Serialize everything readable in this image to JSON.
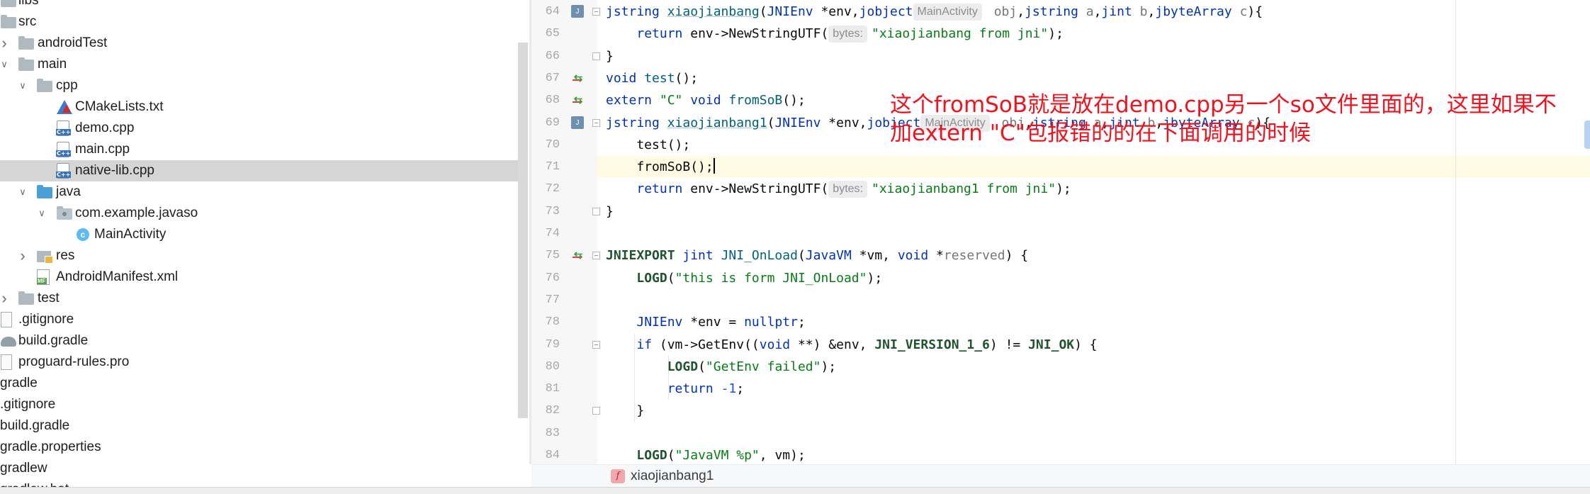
{
  "project_tree": {
    "items": [
      {
        "label": "libs",
        "indent": 0,
        "icon": "folder-icon",
        "chevron": ""
      },
      {
        "label": "src",
        "indent": 0,
        "icon": "folder-icon",
        "chevron": "down"
      },
      {
        "label": "androidTest",
        "indent": 1,
        "icon": "folder-icon",
        "chevron": "right"
      },
      {
        "label": "main",
        "indent": 1,
        "icon": "folder-icon",
        "chevron": "down"
      },
      {
        "label": "cpp",
        "indent": 2,
        "icon": "folder-icon",
        "chevron": "down"
      },
      {
        "label": "CMakeLists.txt",
        "indent": 3,
        "icon": "cmake-icon",
        "chevron": ""
      },
      {
        "label": "demo.cpp",
        "indent": 3,
        "icon": "cpp-file-icon",
        "chevron": ""
      },
      {
        "label": "main.cpp",
        "indent": 3,
        "icon": "cpp-file-icon",
        "chevron": ""
      },
      {
        "label": "native-lib.cpp",
        "indent": 3,
        "icon": "cpp-file-icon",
        "chevron": "",
        "selected": true
      },
      {
        "label": "java",
        "indent": 2,
        "icon": "source-folder-icon",
        "chevron": "down"
      },
      {
        "label": "com.example.javaso",
        "indent": 3,
        "icon": "package-icon",
        "chevron": "down"
      },
      {
        "label": "MainActivity",
        "indent": 4,
        "icon": "class-icon",
        "chevron": ""
      },
      {
        "label": "res",
        "indent": 2,
        "icon": "resources-folder-icon",
        "chevron": "right"
      },
      {
        "label": "AndroidManifest.xml",
        "indent": 2,
        "icon": "manifest-file-icon",
        "chevron": ""
      },
      {
        "label": "test",
        "indent": 1,
        "icon": "folder-icon",
        "chevron": "right"
      },
      {
        "label": ".gitignore",
        "indent": 0,
        "icon": "gitignore-file-icon",
        "chevron": ""
      },
      {
        "label": "build.gradle",
        "indent": 0,
        "icon": "gradle-file-icon",
        "chevron": ""
      },
      {
        "label": "proguard-rules.pro",
        "indent": 0,
        "icon": "file-icon",
        "chevron": ""
      },
      {
        "label": "gradle",
        "indent": -1,
        "icon": "",
        "chevron": ""
      },
      {
        "label": ".gitignore",
        "indent": -1,
        "icon": "",
        "chevron": ""
      },
      {
        "label": "build.gradle",
        "indent": -1,
        "icon": "",
        "chevron": ""
      },
      {
        "label": "gradle.properties",
        "indent": -1,
        "icon": "",
        "chevron": ""
      },
      {
        "label": "gradlew",
        "indent": -1,
        "icon": "",
        "chevron": ""
      },
      {
        "label": "gradlew.bat",
        "indent": -1,
        "icon": "",
        "chevron": ""
      }
    ]
  },
  "editor": {
    "line_numbers": [
      "64",
      "65",
      "66",
      "67",
      "68",
      "69",
      "70",
      "71",
      "72",
      "73",
      "74",
      "75",
      "76",
      "77",
      "78",
      "79",
      "80",
      "81",
      "82",
      "83",
      "84"
    ],
    "lines": [
      [
        [
          "typ",
          "jstring "
        ],
        [
          "fnu",
          "xiaojianbang"
        ],
        [
          "",
          "("
        ],
        [
          "typ",
          "JNIEnv"
        ],
        [
          "",
          " *env,"
        ],
        [
          "typ",
          "jobject"
        ],
        [
          "hint",
          "MainActivity"
        ],
        [
          "par",
          " obj"
        ],
        [
          "",
          ","
        ],
        [
          "typ",
          "jstring"
        ],
        [
          "par",
          " a"
        ],
        [
          "",
          ","
        ],
        [
          "typ",
          "jint"
        ],
        [
          "par",
          " b"
        ],
        [
          "",
          ","
        ],
        [
          "typ",
          "jbyteArray"
        ],
        [
          "par",
          " c"
        ],
        [
          "",
          "){"
        ]
      ],
      [
        [
          "",
          "    "
        ],
        [
          "kw",
          "return"
        ],
        [
          "",
          " env->NewStringUTF("
        ],
        [
          "hint",
          "bytes:"
        ],
        [
          "str",
          "\"xiaojianbang from jni\""
        ],
        [
          "",
          ");"
        ]
      ],
      [
        [
          "",
          "}"
        ]
      ],
      [
        [
          "kw",
          "void "
        ],
        [
          "fn",
          "test"
        ],
        [
          "",
          "();"
        ]
      ],
      [
        [
          "kw",
          "extern "
        ],
        [
          "str",
          "\"C\" "
        ],
        [
          "kw",
          "void "
        ],
        [
          "fn",
          "fromSoB"
        ],
        [
          "",
          "();"
        ]
      ],
      [
        [
          "typ",
          "jstring "
        ],
        [
          "fnu",
          "xiaojianbang1"
        ],
        [
          "",
          "("
        ],
        [
          "typ",
          "JNIEnv"
        ],
        [
          "",
          " *env,"
        ],
        [
          "typ",
          "jobject"
        ],
        [
          "hint",
          "MainActivity"
        ],
        [
          "par",
          " obj"
        ],
        [
          "",
          ","
        ],
        [
          "typ",
          "jstring"
        ],
        [
          "par",
          " a"
        ],
        [
          "",
          ","
        ],
        [
          "typ",
          "jint"
        ],
        [
          "par",
          " b"
        ],
        [
          "",
          ","
        ],
        [
          "typ",
          "jbyteArray"
        ],
        [
          "par",
          " c"
        ],
        [
          "",
          "){"
        ]
      ],
      [
        [
          "",
          "    test();"
        ]
      ],
      [
        [
          "",
          "    fromSoB();"
        ],
        [
          "caret",
          ""
        ]
      ],
      [
        [
          "",
          "    "
        ],
        [
          "kw",
          "return"
        ],
        [
          "",
          " env->NewStringUTF("
        ],
        [
          "hint",
          "bytes:"
        ],
        [
          "str",
          "\"xiaojianbang1 from jni\""
        ],
        [
          "",
          ");"
        ]
      ],
      [
        [
          "",
          "}"
        ]
      ],
      [],
      [
        [
          "mac",
          "JNIEXPORT "
        ],
        [
          "typ",
          "jint "
        ],
        [
          "fn",
          "JNI_OnLoad"
        ],
        [
          "",
          "("
        ],
        [
          "typ",
          "JavaVM"
        ],
        [
          "",
          " *vm, "
        ],
        [
          "kw",
          "void"
        ],
        [
          "",
          " *"
        ],
        [
          "par",
          "reserved"
        ],
        [
          "",
          ") {"
        ]
      ],
      [
        [
          "",
          "    "
        ],
        [
          "mac",
          "LOGD"
        ],
        [
          "",
          "("
        ],
        [
          "str",
          "\"this is form JNI_OnLoad\""
        ],
        [
          "",
          ");"
        ]
      ],
      [],
      [
        [
          "",
          "    "
        ],
        [
          "typ",
          "JNIEnv"
        ],
        [
          "",
          " *env = "
        ],
        [
          "kw",
          "nullptr"
        ],
        [
          "",
          ";"
        ]
      ],
      [
        [
          "",
          "    "
        ],
        [
          "kw",
          "if"
        ],
        [
          "",
          " (vm->GetEnv(("
        ],
        [
          "kw",
          "void"
        ],
        [
          "",
          " **) &env, "
        ],
        [
          "mac",
          "JNI_VERSION_1_6"
        ],
        [
          "",
          ") != "
        ],
        [
          "mac",
          "JNI_OK"
        ],
        [
          "",
          ") {"
        ]
      ],
      [
        [
          "",
          "        "
        ],
        [
          "mac",
          "LOGD"
        ],
        [
          "",
          "("
        ],
        [
          "str",
          "\"GetEnv failed\""
        ],
        [
          "",
          ");"
        ]
      ],
      [
        [
          "",
          "        "
        ],
        [
          "kw",
          "return"
        ],
        [
          "",
          " "
        ],
        [
          "num",
          "-1"
        ],
        [
          "",
          ";"
        ]
      ],
      [
        [
          "",
          "    }"
        ]
      ],
      [],
      [
        [
          "",
          "    "
        ],
        [
          "mac",
          "LOGD"
        ],
        [
          "",
          "("
        ],
        [
          "str",
          "\"JavaVM %p\""
        ],
        [
          "",
          ", vm);"
        ]
      ]
    ],
    "gutter_icons": {
      "0": "doc",
      "3": "arrows",
      "4": "arrows",
      "5": "doc",
      "11": "arrows"
    },
    "fold_markers": {
      "0": "open",
      "2": "end",
      "5": "open",
      "9": "end",
      "11": "open",
      "15": "open",
      "18": "end"
    },
    "current_line_index": 7
  },
  "annotation": {
    "line1": "这个fromSoB就是放在demo.cpp另一个so文件里面的，这里如果不",
    "line2": "加extern \"C\"包报错的的在下面调用的时候"
  },
  "breadcrumb": {
    "icon_letter": "f",
    "label": "xiaojianbang1"
  },
  "colors": {
    "annotation": "#f0131e",
    "selection": "#d5d5d5",
    "current_line": "#fffae3"
  }
}
